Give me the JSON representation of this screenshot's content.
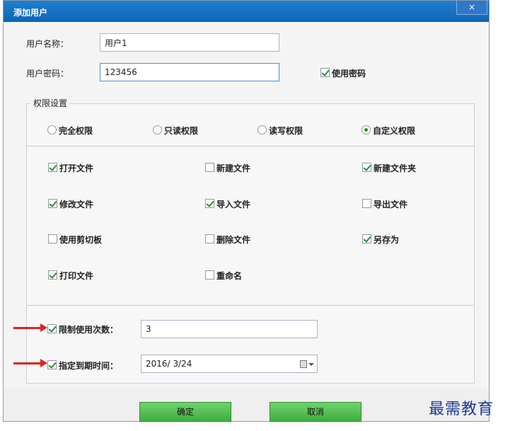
{
  "window": {
    "title": "添加用户",
    "close_glyph": "×"
  },
  "user": {
    "name_label": "用户名称：",
    "name_value": "用户1",
    "password_label": "用户密码：",
    "password_value": "123456",
    "use_password_label": "使用密码",
    "use_password_checked": true
  },
  "permissions": {
    "group_title": "权限设置",
    "modes": [
      {
        "label": "完全权限",
        "selected": false
      },
      {
        "label": "只读权限",
        "selected": false
      },
      {
        "label": "读写权限",
        "selected": false
      },
      {
        "label": "自定义权限",
        "selected": true
      }
    ],
    "items": [
      {
        "label": "打开文件",
        "checked": true
      },
      {
        "label": "新建文件",
        "checked": false
      },
      {
        "label": "新建文件夹",
        "checked": true
      },
      {
        "label": "修改文件",
        "checked": true
      },
      {
        "label": "导入文件",
        "checked": true
      },
      {
        "label": "导出文件",
        "checked": false
      },
      {
        "label": "使用剪切板",
        "checked": false
      },
      {
        "label": "删除文件",
        "checked": false
      },
      {
        "label": "另存为",
        "checked": true
      },
      {
        "label": "打印文件",
        "checked": true
      },
      {
        "label": "重命名",
        "checked": false
      }
    ],
    "limit_uses": {
      "label": "限制使用次数：",
      "checked": true,
      "value": "3"
    },
    "expiry": {
      "label": "指定到期时间：",
      "checked": true,
      "value": "2016/  3/24"
    }
  },
  "buttons": {
    "ok": "确定",
    "cancel": "取消"
  },
  "watermark": "最需教育",
  "colors": {
    "title_bar": "#1473c9",
    "button_green": "#4cbb4c",
    "arrow_red": "#e02020",
    "check_green": "#2e8b2e"
  }
}
